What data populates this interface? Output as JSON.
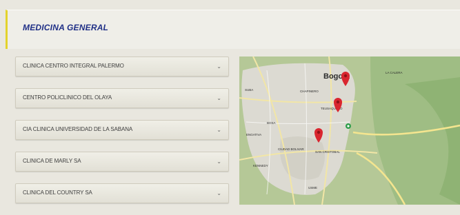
{
  "header": {
    "title": "MEDICINA GENERAL"
  },
  "clinics": [
    {
      "label": "CLINICA CENTRO INTEGRAL PALERMO"
    },
    {
      "label": "CENTRO POLICLINICO DEL OLAYA"
    },
    {
      "label": "CIA CLINICA UNIVERSIDAD DE LA SABANA"
    },
    {
      "label": "CLINICA DE MARLY SA"
    },
    {
      "label": "CLINICA DEL COUNTRY SA"
    }
  ],
  "map": {
    "city_label": "Bogotá",
    "place_labels": {
      "l1": "CHAPINERO",
      "l2": "TEUSAQUILLO",
      "l3": "BOSA",
      "l4": "CIUDAD BOLIVAR",
      "l5": "SAN CRISTOBAL",
      "l6": "SUBA",
      "l7": "ENGATIVA",
      "l8": "KENNEDY",
      "l9": "USME",
      "l10": "LA CALERA"
    },
    "marker_color": "#d9262f"
  }
}
